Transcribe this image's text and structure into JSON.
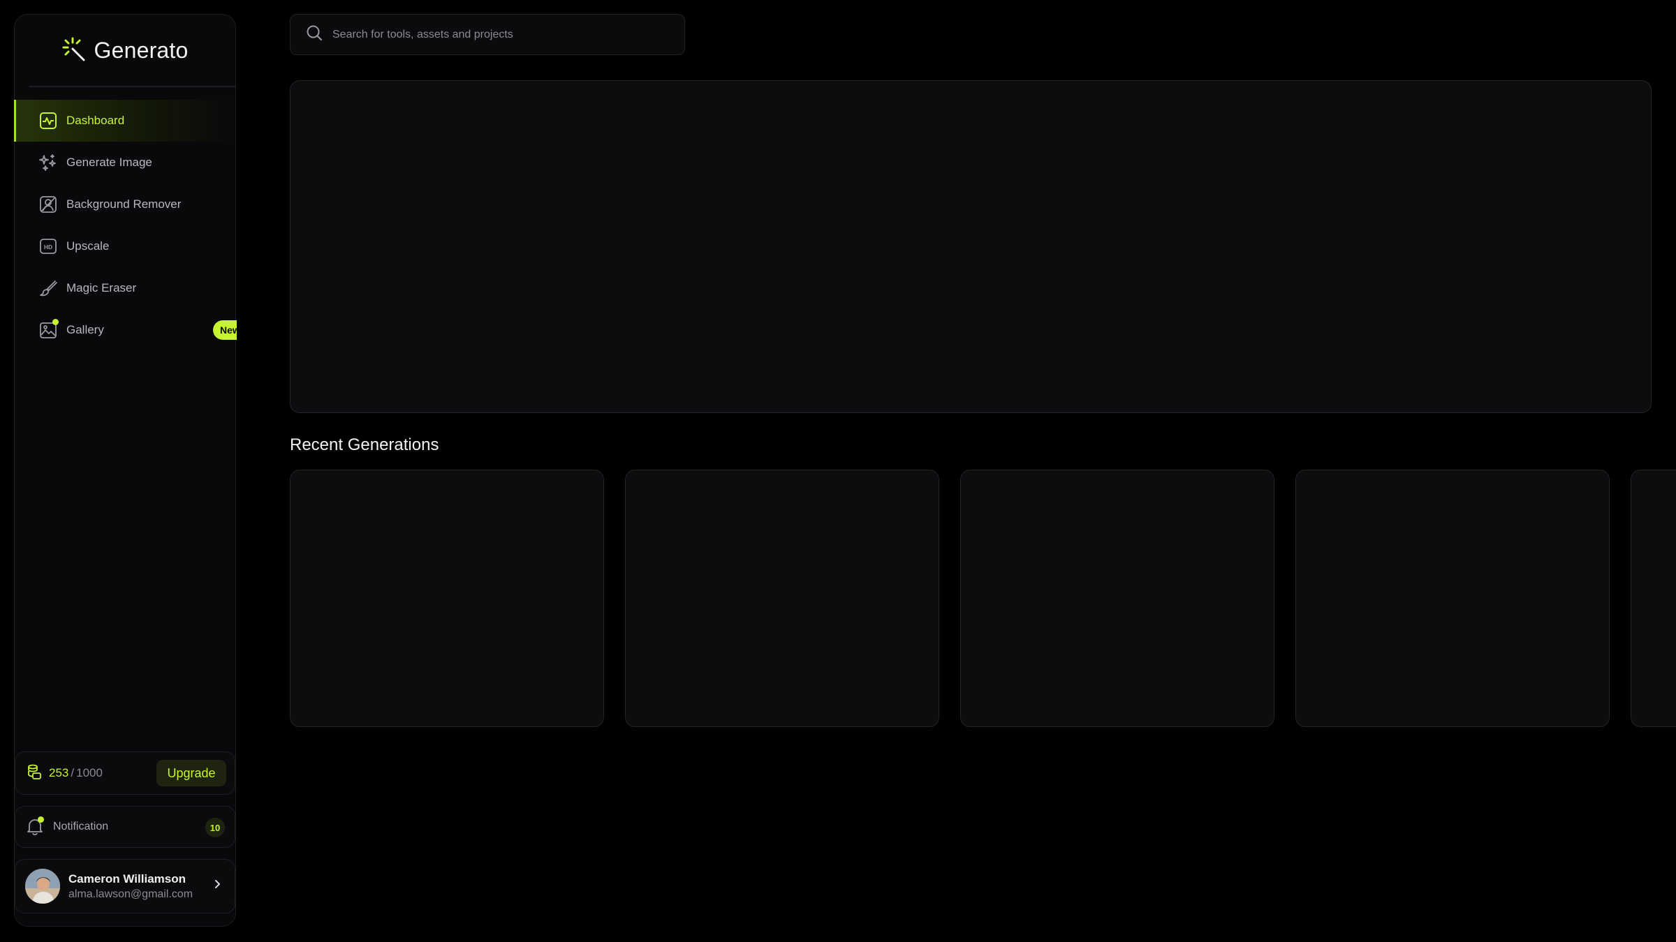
{
  "app": {
    "name": "Generato"
  },
  "search": {
    "placeholder": "Search for tools, assets and projects"
  },
  "sidebar": {
    "items": [
      {
        "label": "Dashboard",
        "icon": "dashboard-icon",
        "active": true
      },
      {
        "label": "Generate Image",
        "icon": "sparkles-icon"
      },
      {
        "label": "Background Remover",
        "icon": "background-remover-icon"
      },
      {
        "label": "Upscale",
        "icon": "hd-icon"
      },
      {
        "label": "Magic Eraser",
        "icon": "brush-icon"
      },
      {
        "label": "Gallery",
        "icon": "gallery-icon",
        "badge": "New"
      }
    ]
  },
  "credits": {
    "used": "253",
    "separator": "/",
    "total": "1000",
    "upgrade_label": "Upgrade"
  },
  "notification": {
    "label": "Notification",
    "count": "10"
  },
  "user": {
    "name": "Cameron Williamson",
    "email": "alma.lawson@gmail.com"
  },
  "main": {
    "recent_title": "Recent Generations"
  },
  "colors": {
    "accent": "#c6f432",
    "background": "#000000",
    "panel": "#0d0d10",
    "border": "#232328"
  }
}
